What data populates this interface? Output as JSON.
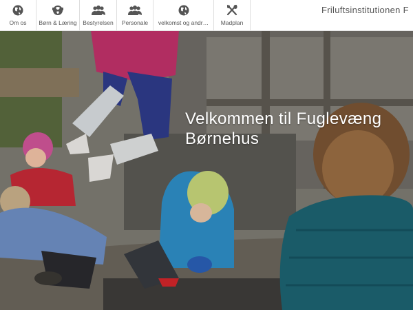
{
  "nav": {
    "items": [
      {
        "label": "Om os",
        "icon": "globe-icon"
      },
      {
        "label": "Børn & Læring",
        "icon": "puzzle-globe-icon"
      },
      {
        "label": "Bestyrelsen",
        "icon": "group-icon"
      },
      {
        "label": "Personale",
        "icon": "staff-icon"
      },
      {
        "label": "velkomst og andr…",
        "icon": "globe-icon"
      },
      {
        "label": "Madplan",
        "icon": "cutlery-icon"
      }
    ]
  },
  "header": {
    "site_title": "Friluftsinstitutionen F"
  },
  "hero": {
    "title_line1": "Velkommen til Fuglevæng",
    "title_line2": "Børnehus"
  },
  "colors": {
    "nav_icon": "#555555",
    "nav_text": "#555555",
    "hero_text": "#ffffff"
  }
}
